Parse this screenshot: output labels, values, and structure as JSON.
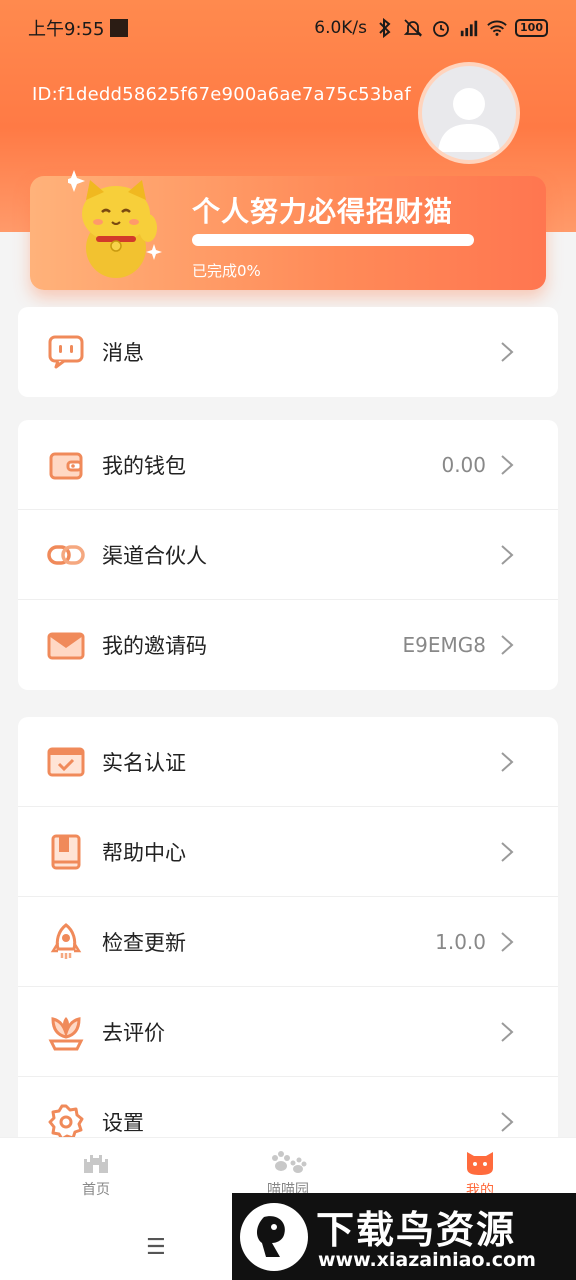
{
  "status": {
    "time": "上午9:55",
    "speed": "6.0K/s",
    "battery": "100"
  },
  "profile": {
    "user_id": "ID:f1dedd58625f67e900a6ae7a75c53baf"
  },
  "banner": {
    "title": "个人努力必得招财猫",
    "progress_text": "已完成0%",
    "progress": 0
  },
  "menu": {
    "group1": [
      {
        "label": "消息",
        "value": ""
      }
    ],
    "group2": [
      {
        "label": "我的钱包",
        "value": "0.00"
      },
      {
        "label": "渠道合伙人",
        "value": ""
      },
      {
        "label": "我的邀请码",
        "value": "E9EMG8"
      }
    ],
    "group3": [
      {
        "label": "实名认证",
        "value": ""
      },
      {
        "label": "帮助中心",
        "value": ""
      },
      {
        "label": "检查更新",
        "value": "1.0.0"
      },
      {
        "label": "去评价",
        "value": ""
      },
      {
        "label": "设置",
        "value": ""
      }
    ]
  },
  "tabs": [
    {
      "label": "首页",
      "icon": "castle-icon"
    },
    {
      "label": "喵喵园",
      "icon": "paw-icon"
    },
    {
      "label": "我的",
      "icon": "cat-face-icon"
    }
  ],
  "watermark": {
    "title": "下载鸟资源",
    "url": "www.xiazainiao.com"
  },
  "colors": {
    "accent": "#ff7a45",
    "icon": "#f08a5a"
  }
}
